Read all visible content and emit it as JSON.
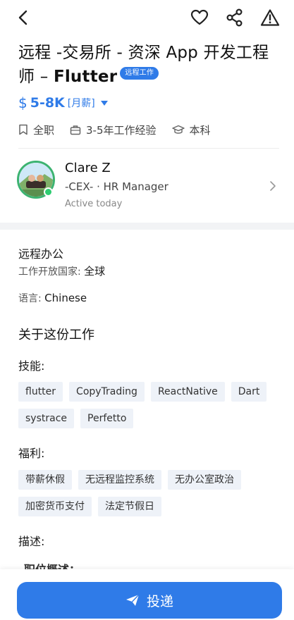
{
  "header": {
    "icons": [
      "back-arrow-icon",
      "heart-icon",
      "share-icon",
      "warning-icon"
    ]
  },
  "job": {
    "title_main": "远程 -交易所 - 资深 App 开发工程师 – ",
    "title_flutter": "Flutter",
    "remote_badge": "远程工作",
    "salary_symbol": "$",
    "salary": "5-8K",
    "salary_unit": "[月薪]",
    "meta": {
      "type": "全职",
      "experience": "3-5年工作经验",
      "education": "本科"
    }
  },
  "recruiter": {
    "name": "Clare Z",
    "role": "-CEX- · HR Manager",
    "active": "Active today"
  },
  "details": {
    "remote_label": "远程办公",
    "countries_label": "工作开放国家: ",
    "countries_value": "全球",
    "language_label": "语言: ",
    "language_value": "Chinese",
    "about_heading": "关于这份工作",
    "skills_label": "技能:",
    "skills": [
      "flutter",
      "CopyTrading",
      "ReactNative",
      "Dart",
      "systrace",
      "Perfetto"
    ],
    "benefits_label": "福利:",
    "benefits": [
      "带薪休假",
      "无远程监控系统",
      "无办公室政治",
      "加密货币支付",
      "法定节假日"
    ],
    "description_label": "描述:",
    "description_cut": "职位概述："
  },
  "action": {
    "apply_label": "投递"
  },
  "colors": {
    "accent": "#2f7be8",
    "tag_bg": "#eef2f8",
    "online": "#2ecc71"
  }
}
